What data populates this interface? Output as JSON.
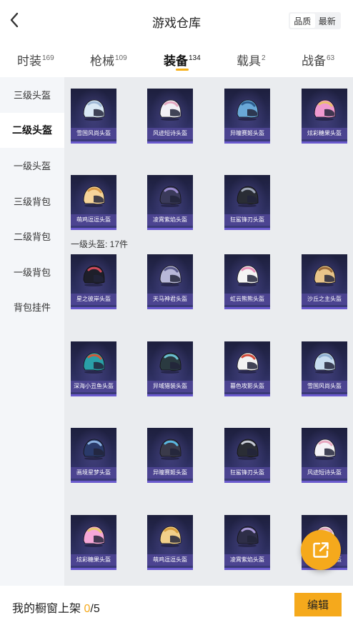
{
  "header": {
    "title": "游戏仓库",
    "sort_options": [
      "品质",
      "最新"
    ],
    "sort_active": 0
  },
  "tabs": [
    {
      "label": "时装",
      "count": "169"
    },
    {
      "label": "枪械",
      "count": "109"
    },
    {
      "label": "装备",
      "count": "134"
    },
    {
      "label": "载具",
      "count": "2"
    },
    {
      "label": "战备",
      "count": "63"
    }
  ],
  "sidebar": {
    "items": [
      "三级头盔",
      "二级头盔",
      "一级头盔",
      "三级背包",
      "二级背包",
      "一级背包",
      "背包挂件"
    ],
    "active": 1
  },
  "sections": {
    "level1_label": "一级头盔: 17件"
  },
  "items_level2": [
    {
      "name": "雪国风尚头盔",
      "colors": [
        "#d9e8f5",
        "#9fb8d6"
      ]
    },
    {
      "name": "风迹短诗头盔",
      "colors": [
        "#f2f0f5",
        "#e4a8c0"
      ]
    },
    {
      "name": "异瞳赛姬头盔",
      "colors": [
        "#6aa8d8",
        "#2c5d8f"
      ]
    },
    {
      "name": "炫彩糖果头盔",
      "colors": [
        "#f09ad0",
        "#e8c06a"
      ]
    },
    {
      "name": "萌鸡逗逗头盔",
      "colors": [
        "#f6d49a",
        "#d99b4a"
      ]
    },
    {
      "name": "凌霄紫焰头盔",
      "colors": [
        "#3a3a5a",
        "#9b8bd0"
      ]
    },
    {
      "name": "狂鲨锋刃头盔",
      "colors": [
        "#2a2d35",
        "#a0a8b8"
      ]
    }
  ],
  "items_level1": [
    {
      "name": "星之彼岸头盔",
      "colors": [
        "#1e1f2a",
        "#d04a5a"
      ]
    },
    {
      "name": "天马神君头盔",
      "colors": [
        "#b8b8d8",
        "#5a5a8a"
      ]
    },
    {
      "name": "虹云熊熊头盔",
      "colors": [
        "#f4f4f4",
        "#e890b8"
      ]
    },
    {
      "name": "沙丘之主头盔",
      "colors": [
        "#e8c48a",
        "#9a6a3a"
      ]
    },
    {
      "name": "深海小丑鱼头盔",
      "colors": [
        "#2aa0a8",
        "#d05a3a"
      ]
    },
    {
      "name": "异域猎装头盔",
      "colors": [
        "#2a3a40",
        "#6ac0d0"
      ]
    },
    {
      "name": "暮色攻影头盔",
      "colors": [
        "#f2f2f2",
        "#d04a3a"
      ]
    },
    {
      "name": "雪国风尚头盔",
      "colors": [
        "#c8ddf0",
        "#8eaed0"
      ]
    },
    {
      "name": "画境星梦头盔",
      "colors": [
        "#2a3a6a",
        "#8ab0e0"
      ]
    },
    {
      "name": "异瞳赛姬头盔",
      "colors": [
        "#3a3a4a",
        "#5ab8e0"
      ]
    },
    {
      "name": "狂鲨锋刃头盔",
      "colors": [
        "#2a2d35",
        "#c8ccd6"
      ]
    },
    {
      "name": "风迹短诗头盔",
      "colors": [
        "#f4f2f6",
        "#e8a8c0"
      ]
    },
    {
      "name": "炫彩糖果头盔",
      "colors": [
        "#f6a8d8",
        "#e8c870"
      ]
    },
    {
      "name": "萌鸡逗逗头盔",
      "colors": [
        "#f2d08a",
        "#d8a040"
      ]
    },
    {
      "name": "凌霄紫焰头盔",
      "colors": [
        "#2e2e48",
        "#a898d8"
      ]
    },
    {
      "name": "风迹短诗头盔",
      "colors": [
        "#f4f2f6",
        "#e8a8c0"
      ]
    }
  ],
  "bottom": {
    "shelf_label": "我的橱窗上架",
    "shelf_current": "0",
    "shelf_total": "/5",
    "edit_label": "编辑"
  },
  "colors": {
    "accent": "#f5a91c",
    "sidebar_bg": "#f4f6f9",
    "content_bg": "#eaecef"
  }
}
